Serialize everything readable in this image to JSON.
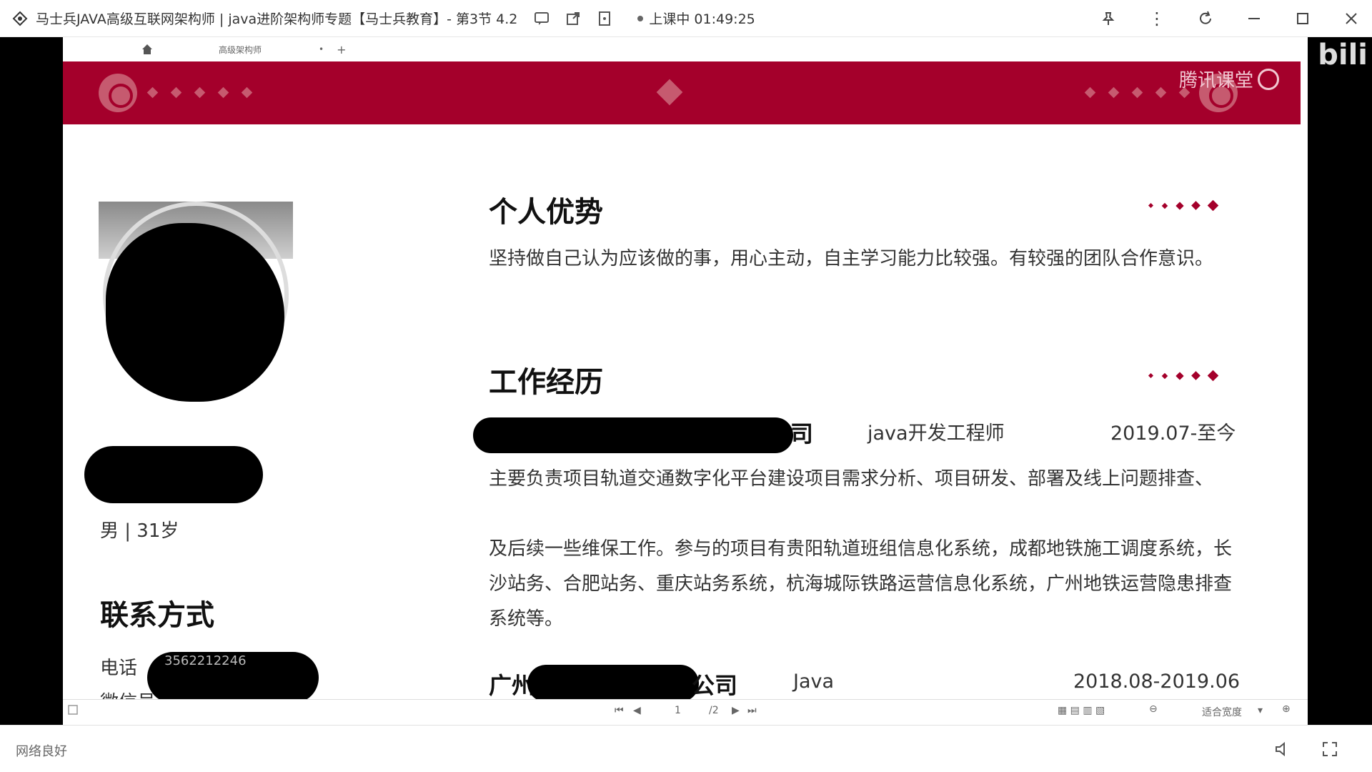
{
  "titlebar": {
    "title": "马士兵JAVA高级互联网架构师 | java进阶架构师专题【马士兵教育】- 第3节 4.2",
    "status": "上课中 01:49:25"
  },
  "tabstrip": {
    "tab_label": "高级架构师",
    "close": "•",
    "add": "+"
  },
  "watermark": {
    "tencent": "腾讯课堂",
    "bilibili": "bili"
  },
  "resume": {
    "gender_age": "男 | 31岁",
    "contact_title": "联系方式",
    "phone_label": "电话",
    "phone_number": "3562212246",
    "wechat_label": "微信号",
    "advantage_title": "个人优势",
    "advantage_text": "坚持做自己认为应该做的事，用心主动，自主学习能力比较强。有较强的团队合作意识。",
    "work_title": "工作经历",
    "job1": {
      "company_tail": "司",
      "role": "java开发工程师",
      "date": "2019.07-至今",
      "desc1": "主要负责项目轨道交通数字化平台建设项目需求分析、项目研发、部署及线上问题排查、",
      "desc2": "及后续一些维保工作。参与的项目有贵阳轨道班组信息化系统，成都地铁施工调度系统，长沙站务、合肥站务、重庆站务系统，杭海城际铁路运营信息化系统，广州地铁运营隐患排查系统等。"
    },
    "job2": {
      "company_head": "广州",
      "company_tail": "公司",
      "role": "Java",
      "date": "2018.08-2019.06"
    }
  },
  "viewer_bar": {
    "page_current": "1",
    "page_total": "/2",
    "fit_label": "适合宽度"
  },
  "statusbar": {
    "network": "网络良好"
  }
}
